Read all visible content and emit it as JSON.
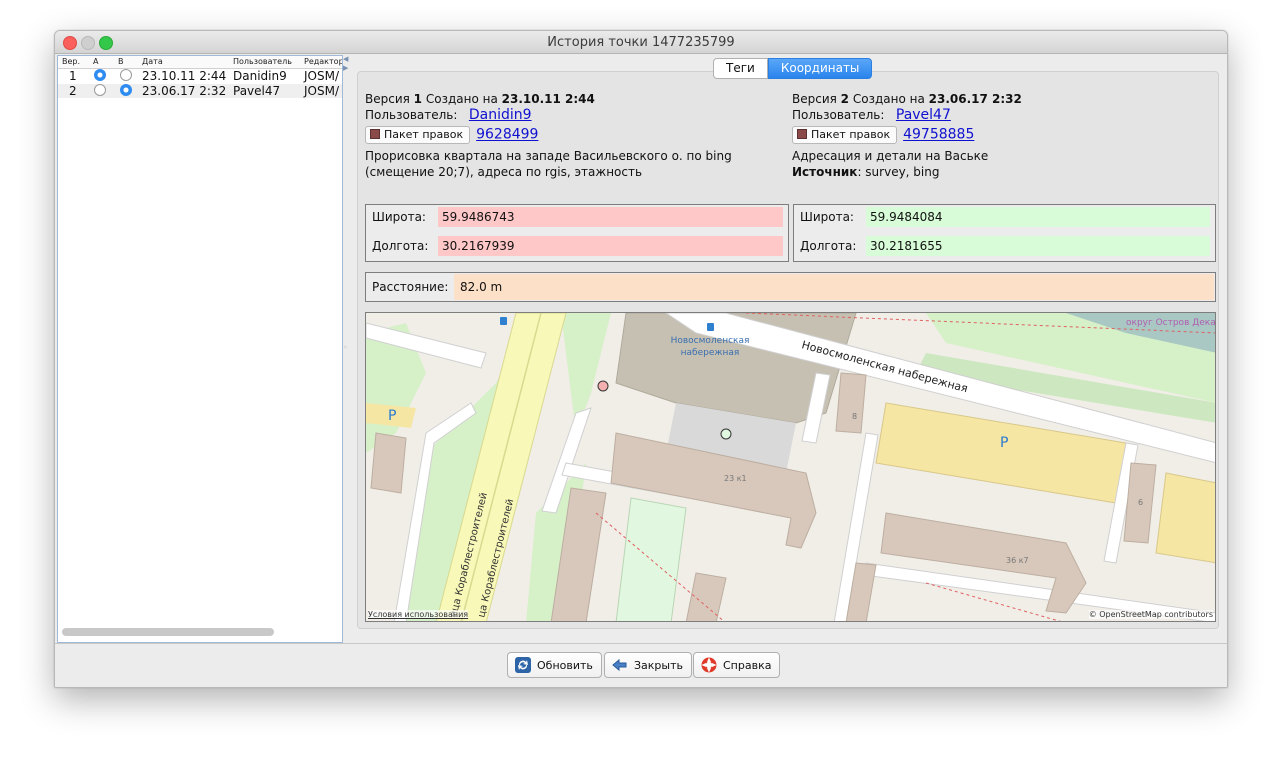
{
  "window": {
    "title": "История точки 1477235799"
  },
  "history": {
    "columns": [
      "Вер.",
      "A",
      "B",
      "Дата",
      "Пользователь",
      "Редактор"
    ],
    "rows": [
      {
        "ver": "1",
        "a_selected": true,
        "b_selected": false,
        "date": "23.10.11 2:44",
        "user": "Danidin9",
        "editor": "JOSM/"
      },
      {
        "ver": "2",
        "a_selected": false,
        "b_selected": true,
        "date": "23.06.17 2:32",
        "user": "Pavel47",
        "editor": "JOSM/"
      }
    ]
  },
  "tabs": {
    "tags": "Теги",
    "coords": "Координаты",
    "active": "coords"
  },
  "left_version": {
    "version_prefix": "Версия ",
    "version": "1",
    "created_on": " Создано на ",
    "date": "23.10.11 2:44",
    "user_label": "Пользователь:",
    "user": "Danidin9",
    "changeset_button": "Пакет правок",
    "changeset": "9628499",
    "comment": "Прорисовка квартала на западе Васильевского о. по bing (смещение 20;7), адреса по rgis, этажность",
    "lat_label": "Широта:",
    "lat": "59.9486743",
    "lon_label": "Долгота:",
    "lon": "30.2167939"
  },
  "right_version": {
    "version_prefix": "Версия ",
    "version": "2",
    "created_on": " Создано на ",
    "date": "23.06.17 2:32",
    "user_label": "Пользователь:",
    "user": "Pavel47",
    "changeset_button": "Пакет правок",
    "changeset": "49758885",
    "comment": "Адресация и детали на Ваське",
    "source_label": "Источник",
    "source": ": survey, bing",
    "lat_label": "Широта:",
    "lat": "59.9484084",
    "lon_label": "Долгота:",
    "lon": "30.2181655"
  },
  "distance": {
    "label": "Расстояние:",
    "value": "82.0 m"
  },
  "map": {
    "street_main": "Новосмоленская набережная",
    "street_label_1": "Новосмоленская",
    "street_label_2": "набережная",
    "avenue_1": "ица Кораблестроителей",
    "avenue_2": "ца Кораблестроителей",
    "district": "округ Остров Декаб",
    "building_23": "23 к1",
    "building_36": "36 к7",
    "building_8": "8",
    "building_6": "6",
    "parking": "P",
    "attr_left": "Условия использования",
    "attr_right": "© OpenStreetMap contributors",
    "colors": {
      "old_point": "#f4b0b0",
      "new_point": "#e0f7e0",
      "road": "#f8f8b8",
      "park": "#d6f0c8"
    }
  },
  "buttons": {
    "refresh": "Обновить",
    "close": "Закрыть",
    "help": "Справка"
  }
}
